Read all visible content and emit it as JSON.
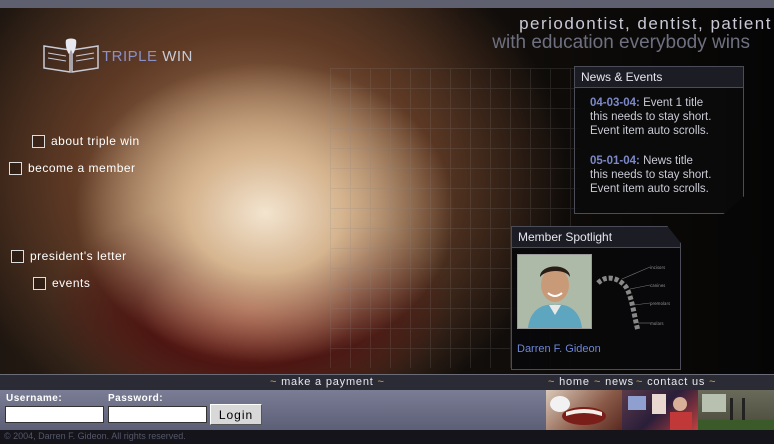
{
  "brand": {
    "logo_text_a": "TRIPLE",
    "logo_text_b": "WIN"
  },
  "tagline": {
    "line1": "periodontist, dentist, patient",
    "line2": "with education everybody wins"
  },
  "nav": {
    "about": "about triple win",
    "member": "become a member",
    "president": "president's letter",
    "events": "events"
  },
  "news": {
    "title": "News &  Events",
    "items": [
      {
        "date": "04-03-04:",
        "text_a": "Event 1 title",
        "text_b": "this needs to stay short.",
        "text_c": "Event item auto scrolls."
      },
      {
        "date": "05-01-04:",
        "text_a": "News  title",
        "text_b": "this needs to stay short.",
        "text_c": "Event item auto scrolls."
      }
    ]
  },
  "spotlight": {
    "title": "Member Spotlight",
    "name": "Darren F. Gideon",
    "diagram_labels": [
      "incisors",
      "canines",
      "premolars",
      "molars"
    ]
  },
  "links": {
    "payment": "make a payment",
    "home": "home",
    "news": "news",
    "contact": "contact us"
  },
  "login": {
    "username_label": "Username:",
    "password_label": "Password:",
    "username_value": "",
    "password_value": "",
    "button": "Login"
  },
  "footer": {
    "copyright": "© 2004, Darren F. Gideon. All rights reserved."
  },
  "colors": {
    "accent": "#7c88c8",
    "name_link": "#6d86d8",
    "dash": "#d8a040",
    "login_bar": "#6a6d85"
  }
}
